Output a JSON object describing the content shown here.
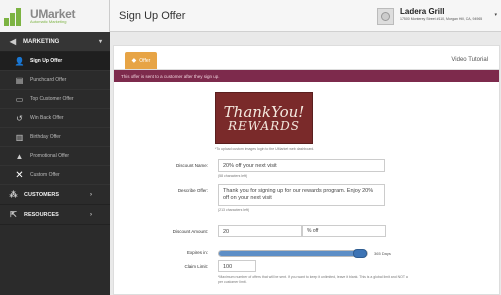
{
  "app": {
    "logo_title": "UMarket",
    "logo_subtitle": "Automatic Marketing"
  },
  "sidebar": {
    "marketing_label": "MARKETING",
    "items": [
      {
        "label": "Sign Up Offer",
        "icon": "user-add-icon",
        "active": true
      },
      {
        "label": "Punchcard Offer",
        "icon": "punchcard-icon",
        "active": false
      },
      {
        "label": "Top Customer Offer",
        "icon": "trophy-icon",
        "active": false
      },
      {
        "label": "Win Back Offer",
        "icon": "winback-icon",
        "active": false
      },
      {
        "label": "Birthday Offer",
        "icon": "cake-icon",
        "active": false
      },
      {
        "label": "Promotional Offer",
        "icon": "megaphone-icon",
        "active": false
      },
      {
        "label": "Custom Offer",
        "icon": "tools-icon",
        "active": false
      }
    ],
    "customers_label": "CUSTOMERS",
    "resources_label": "RESOURCES"
  },
  "header": {
    "title": "Sign Up Offer",
    "store_name": "Ladera Grill",
    "store_address": "17500 Monterey Street #110, Morgan Hill, CA, 94965"
  },
  "tabs": {
    "offer_label": "Offer",
    "video_tutorial": "Video Tutorial"
  },
  "banner": "This offer is sent to a customer after they sign up.",
  "reward_image": {
    "line1": "ThankYou!",
    "line2": "REWARDS",
    "note": "*To upload custom images login to the UMarket web dashboard."
  },
  "form": {
    "discount_name_label": "Discount Name:",
    "discount_name_value": "20% off your next visit",
    "discount_name_hint": "(58 characters left)",
    "describe_label": "Describe Offer:",
    "describe_value": "Thank you for signing up for our rewards program. Enjoy 20% off on your next visit",
    "describe_hint": "(213 characters left)",
    "amount_label": "Discount Amount:",
    "amount_value": "20",
    "amount_suffix": "% off",
    "expires_label": "Expires in:",
    "expires_value": "365 Days",
    "expires_fraction": 1.0,
    "claim_label": "Claim Limit:",
    "claim_value": "100",
    "claim_hint": "*Maximum number of offers that will be sent. If you want to keep it unlimited, leave it blank. This is a global limit and NOT a per customer limit."
  },
  "colors": {
    "accent": "#e7a445",
    "banner": "#7d2a4c",
    "slider": "#3d74b5"
  }
}
